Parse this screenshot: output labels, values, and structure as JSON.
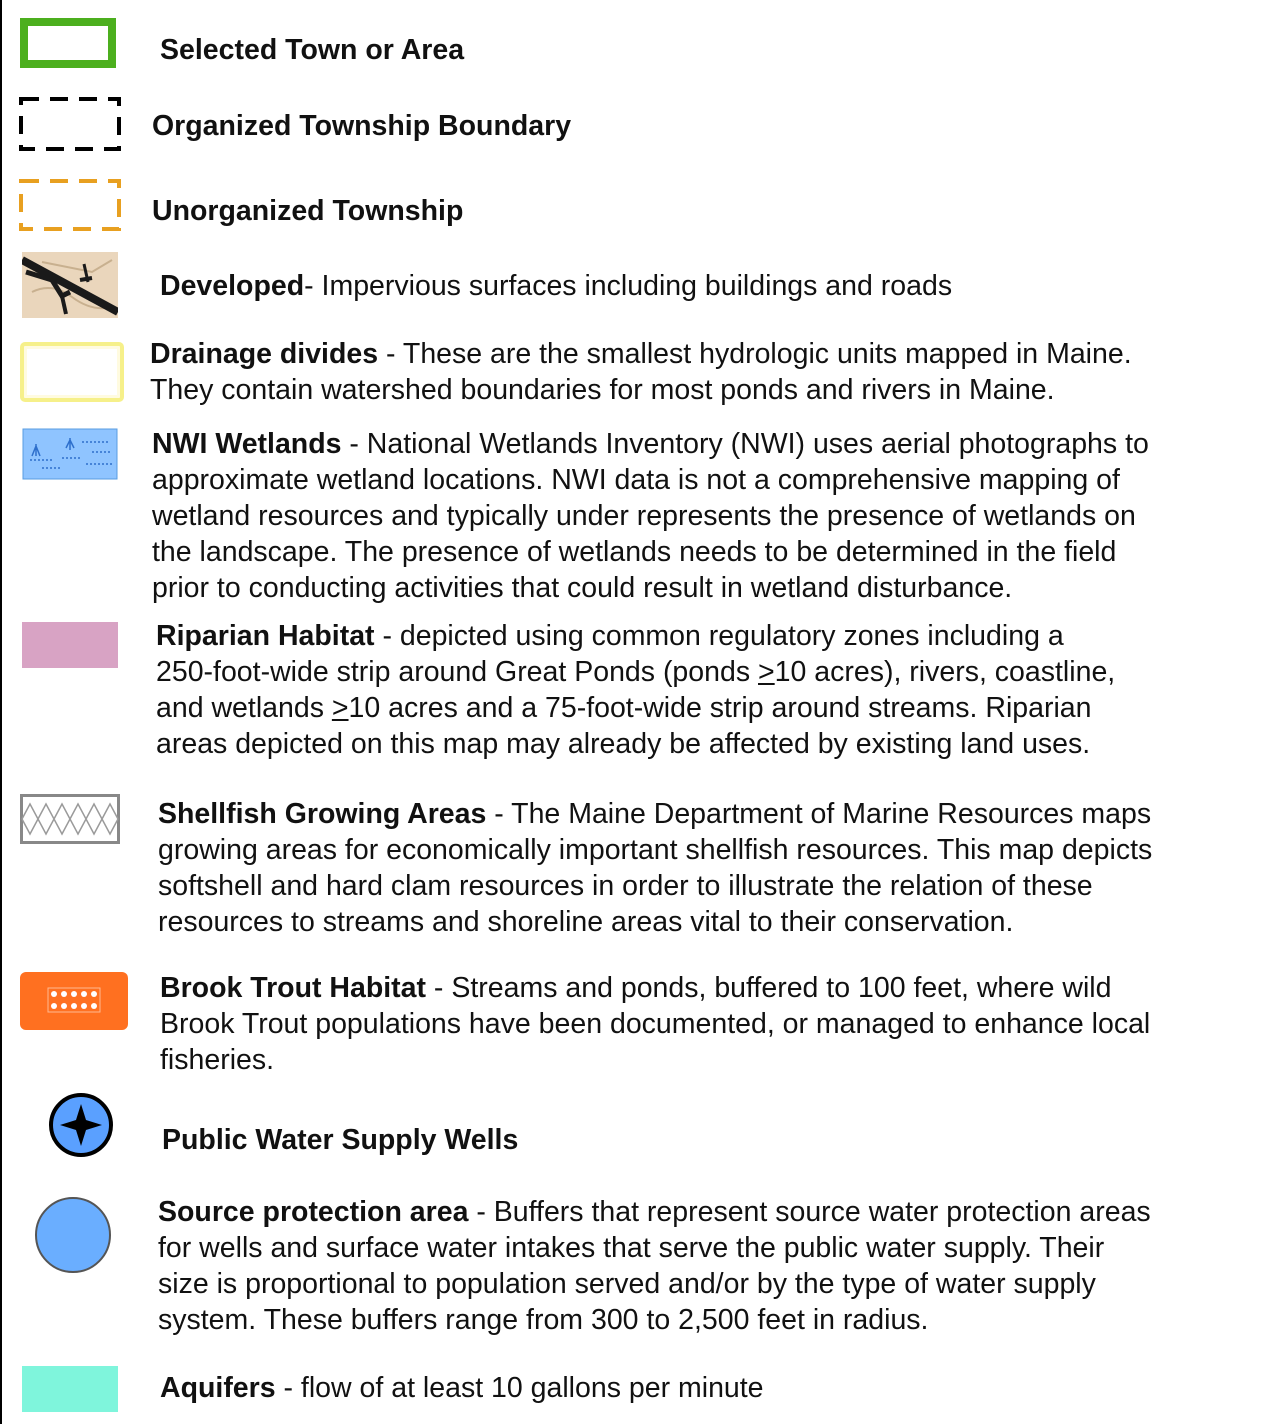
{
  "legend": {
    "selected_town": {
      "title": "Selected Town or Area",
      "color": "#4caf1e"
    },
    "organized_township": {
      "title": "Organized Township Boundary",
      "color": "#000000"
    },
    "unorganized_township": {
      "title": "Unorganized Township",
      "color": "#e8a020"
    },
    "developed": {
      "title": "Developed",
      "desc": "- Impervious surfaces including buildings and roads"
    },
    "drainage": {
      "title": "Drainage divides",
      "desc_1": " - These are the smallest hydrologic units mapped in Maine.",
      "line_2": "They contain watershed boundaries for most ponds and rivers in Maine.",
      "color": "#f6f08a"
    },
    "nwi": {
      "title": "NWI Wetlands",
      "desc_1": " - National Wetlands Inventory (NWI) uses aerial photographs to",
      "line_2": "approximate wetland locations.  NWI data is not a comprehensive mapping of",
      "line_3": "wetland resources and typically under represents the presence of wetlands on",
      "line_4": "the landscape.  The presence of wetlands needs to be determined in the field",
      "line_5": "prior to conducting activities that could result in wetland disturbance.",
      "color": "#8fc4ff"
    },
    "riparian": {
      "title": "Riparian Habitat",
      "desc_1": " - depicted using common regulatory zones including a",
      "line_2a": "250-foot-wide strip around Great Ponds (ponds ",
      "ge": ">",
      "line_2b": "10 acres), rivers, coastline,",
      "line_3a": "and wetlands ",
      "line_3b": "10 acres and a 75-foot-wide strip around streams.  Riparian",
      "line_4": "areas depicted on this map may already be affected by existing land uses.",
      "color": "#d8a3c4"
    },
    "shellfish": {
      "title": "Shellfish Growing Areas",
      "desc_1": " - The Maine Department of Marine Resources maps",
      "line_2": "growing areas for economically important shellfish resources.  This map depicts",
      "line_3": "softshell and hard clam resources in order to illustrate the relation of these",
      "line_4": "resources to streams and shoreline areas vital to their conservation."
    },
    "brook_trout": {
      "title": "Brook Trout Habitat",
      "desc_1": " - Streams and ponds, buffered to 100 feet, where wild",
      "line_2": "Brook Trout populations have been documented, or managed to enhance local",
      "line_3": "fisheries.",
      "color": "#ff7020"
    },
    "wells": {
      "title": "Public Water Supply Wells",
      "color": "#5aa0ff"
    },
    "source": {
      "title": "Source protection area",
      "desc_1": " - Buffers that represent source water protection areas",
      "line_2": "for wells and surface water intakes that serve the public water supply.  Their",
      "line_3": "size is proportional to population served and/or by the type of water supply",
      "line_4": "system.  These buffers range from 300 to 2,500 feet in radius.",
      "color": "#6aaeff"
    },
    "aquifers": {
      "title": "Aquifers",
      "desc": " - flow of at least 10 gallons per minute",
      "color": "#7ff5dc"
    }
  }
}
